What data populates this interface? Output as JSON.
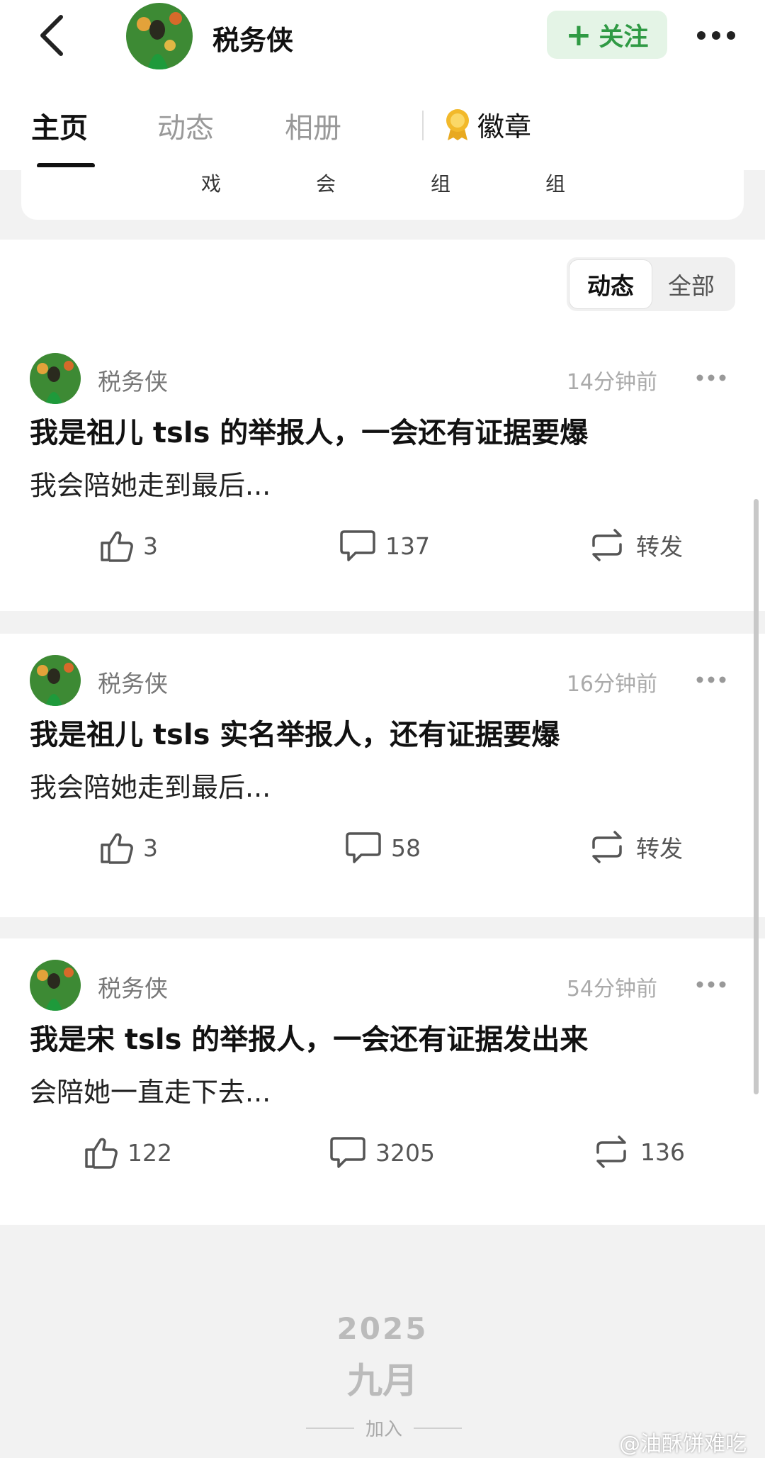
{
  "header": {
    "title": "税务侠",
    "follow_label": "关注",
    "follow_plus": "+"
  },
  "tabs": {
    "home": "主页",
    "feed": "动态",
    "album": "相册",
    "badge": "徽章"
  },
  "groups": [
    "戏",
    "会",
    "组",
    "组"
  ],
  "filter": {
    "active": "动态",
    "all": "全部"
  },
  "posts": [
    {
      "author": "税务侠",
      "time": "14分钟前",
      "headline": "我是祖儿 tsls 的举报人，一会还有证据要爆",
      "excerpt": "我会陪她走到最后...",
      "likes": "3",
      "comments": "137",
      "reposts": "转发"
    },
    {
      "author": "税务侠",
      "time": "16分钟前",
      "headline": "我是祖儿 tsls 实名举报人，还有证据要爆",
      "excerpt": "我会陪她走到最后...",
      "likes": "3",
      "comments": "58",
      "reposts": "转发"
    },
    {
      "author": "税务侠",
      "time": "54分钟前",
      "headline": "我是宋 tsls 的举报人，一会还有证据发出来",
      "excerpt": "会陪她一直走下去...",
      "likes": "122",
      "comments": "3205",
      "reposts": "136"
    }
  ],
  "timeline": {
    "year": "2025",
    "month": "九月",
    "join_label": "加入"
  },
  "watermark": "@油酥饼难吃",
  "colors": {
    "follow_green": "#2f9a44",
    "follow_bg": "#e4f4e6",
    "badge_gold": "#e8a920"
  }
}
